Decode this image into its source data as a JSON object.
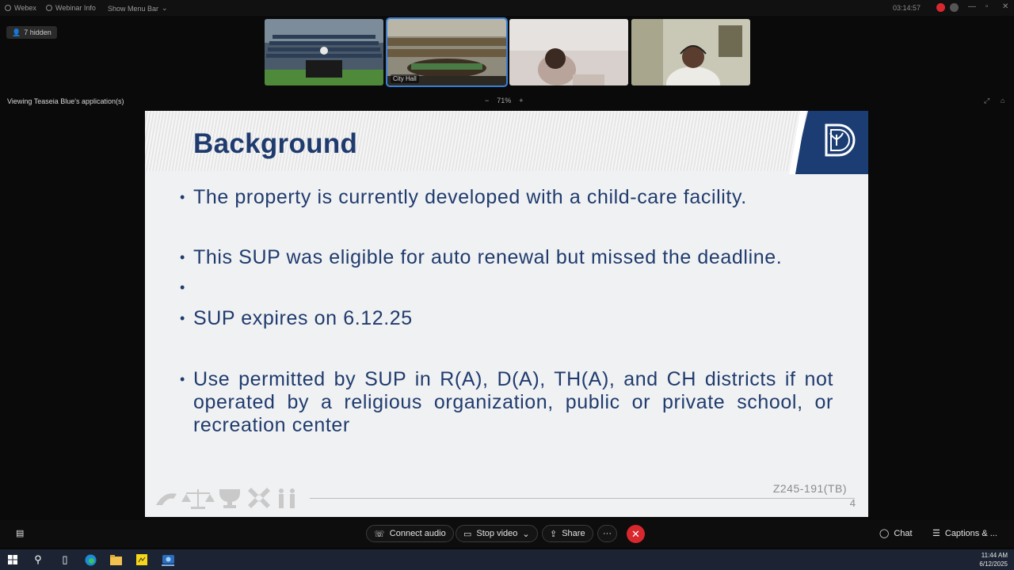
{
  "topbar": {
    "menus": [
      "Webex",
      "Webinar Info",
      "Show Menu Bar"
    ],
    "timer": "03:14:57"
  },
  "hidden_participants": "7 hidden",
  "thumbnails": [
    {
      "label": ""
    },
    {
      "label": "City Hall"
    },
    {
      "label": ""
    },
    {
      "label": ""
    }
  ],
  "viewing_text": "Viewing Teaseia Blue's application(s)",
  "zoom": {
    "minus": "−",
    "level": "71%",
    "plus": "+"
  },
  "slide": {
    "title": "Background",
    "bullets": [
      "The property is currently developed with a child-care facility.",
      "This SUP was eligible for auto renewal but missed the deadline.",
      "",
      "SUP expires on 6.12.25",
      "Use permitted by SUP in R(A), D(A), TH(A), and CH districts if not operated by a religious organization, public or private school, or recreation center"
    ],
    "bullet_char": "•",
    "case_number": "Z245-191(TB)",
    "page_number": "4",
    "brand_color": "#1b3d73"
  },
  "controls": {
    "connect_audio": "Connect audio",
    "stop_video": "Stop video",
    "share": "Share",
    "more": "···",
    "end": "✕",
    "chat": "Chat",
    "captions": "Captions & ..."
  },
  "clock": {
    "time": "11:44 AM",
    "date": "6/12/2025"
  }
}
